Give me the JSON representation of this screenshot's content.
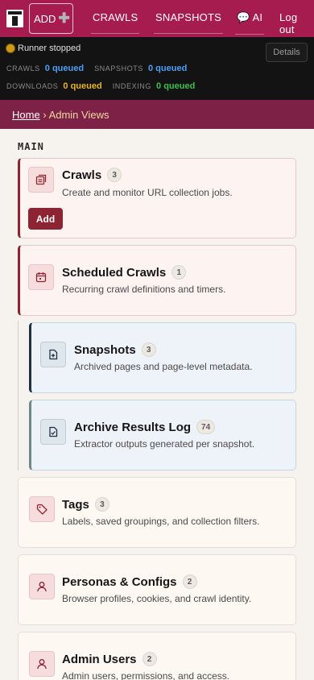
{
  "nav": {
    "add_label": "ADD",
    "crawls_label": "CRAWLS",
    "snapshots_label": "SNAPSHOTS",
    "ai_label": "AI",
    "logout_label": "Log out"
  },
  "status": {
    "runner_text": "Runner stopped",
    "details_label": "Details",
    "crawls_label": "CRAWLS",
    "crawls_value": "0 queued",
    "snapshots_label": "SNAPSHOTS",
    "snapshots_value": "0 queued",
    "downloads_label": "DOWNLOADS",
    "downloads_value": "0 queued",
    "indexing_label": "INDEXING",
    "indexing_value": "0 queued",
    "colors": {
      "crawls": "#4d9ff5",
      "snapshots": "#4d9ff5",
      "downloads": "#e6b427",
      "indexing": "#3fbf4a"
    }
  },
  "breadcrumb": {
    "home": "Home",
    "separator": "›",
    "current": "Admin Views"
  },
  "section": {
    "title": "MAIN"
  },
  "cards": [
    {
      "title": "Crawls",
      "count": "3",
      "desc": "Create and monitor URL collection jobs.",
      "icon": "crawls-icon",
      "action": "Add"
    },
    {
      "title": "Scheduled Crawls",
      "count": "1",
      "desc": "Recurring crawl definitions and timers.",
      "icon": "calendar-icon"
    },
    {
      "title": "Snapshots",
      "count": "3",
      "desc": "Archived pages and page-level metadata.",
      "icon": "document-plus-icon"
    },
    {
      "title": "Archive Results Log",
      "count": "74",
      "desc": "Extractor outputs generated per snapshot.",
      "icon": "document-check-icon"
    },
    {
      "title": "Tags",
      "count": "3",
      "desc": "Labels, saved groupings, and collection filters.",
      "icon": "tag-icon"
    },
    {
      "title": "Personas & Configs",
      "count": "2",
      "desc": "Browser profiles, cookies, and crawl identity.",
      "icon": "user-icon"
    },
    {
      "title": "Admin Users",
      "count": "2",
      "desc": "Admin users, permissions, and access.",
      "icon": "user-icon"
    }
  ]
}
